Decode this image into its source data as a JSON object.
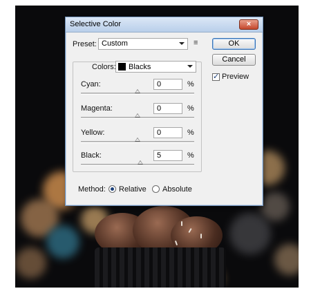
{
  "dialog": {
    "title": "Selective Color",
    "close_label": "×",
    "preset_label": "Preset:",
    "preset_value": "Custom",
    "ok_label": "OK",
    "cancel_label": "Cancel",
    "preview_label": "Preview",
    "preview_checked": true,
    "colors_label": "Colors:",
    "colors_value": "Blacks",
    "colors_swatch": "#000000",
    "sliders": [
      {
        "label": "Cyan:",
        "value": "0",
        "unit": "%"
      },
      {
        "label": "Magenta:",
        "value": "0",
        "unit": "%"
      },
      {
        "label": "Yellow:",
        "value": "0",
        "unit": "%"
      },
      {
        "label": "Black:",
        "value": "5",
        "unit": "%"
      }
    ],
    "method_label": "Method:",
    "methods": [
      {
        "label": "Relative",
        "selected": true
      },
      {
        "label": "Absolute",
        "selected": false
      }
    ]
  },
  "icons": {
    "preset_menu": "preset-options-icon"
  },
  "colors": {
    "accent": "#1a3f7a",
    "titlebar": "#c7d9ef",
    "close": "#c4472c"
  }
}
